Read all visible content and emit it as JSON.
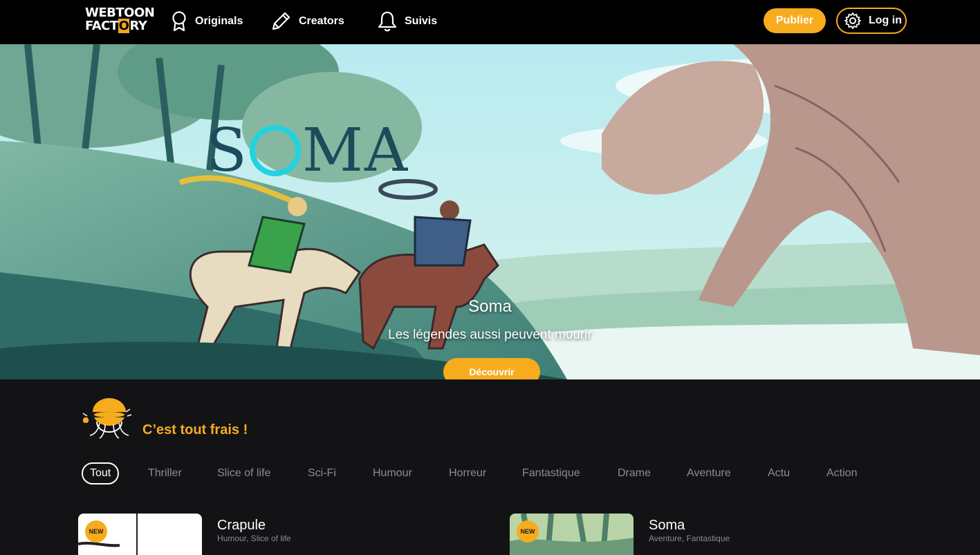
{
  "brand": {
    "line1": "WEBTOON",
    "line2_a": "FACT",
    "line2_hl": "O",
    "line2_b": "RY"
  },
  "nav": {
    "originals": "Originals",
    "creators": "Creators",
    "suivis": "Suivis"
  },
  "actions": {
    "publish": "Publier",
    "login": "Log in"
  },
  "hero": {
    "logo_text_a": "S",
    "logo_text_b": "MA",
    "title": "Soma",
    "subtitle": "Les légendes aussi peuvent mourir",
    "cta": "Découvrir"
  },
  "fresh": {
    "title": "C’est tout frais !",
    "filters": [
      "Tout",
      "Thriller",
      "Slice of life",
      "Sci-Fi",
      "Humour",
      "Horreur",
      "Fantastique",
      "Drame",
      "Aventure",
      "Actu",
      "Action"
    ],
    "active_filter": "Tout",
    "cards": [
      {
        "title": "Crapule",
        "genres": "Humour, Slice of life",
        "badge": "NEW"
      },
      {
        "title": "Soma",
        "genres": "Aventure, Fantastique",
        "badge": "NEW"
      }
    ]
  },
  "colors": {
    "accent": "#f7ac1e",
    "background": "#131316",
    "topbar": "#000000"
  },
  "icons": [
    "medal-icon",
    "pencil-icon",
    "bell-icon",
    "gear-icon",
    "mascot-icon"
  ]
}
